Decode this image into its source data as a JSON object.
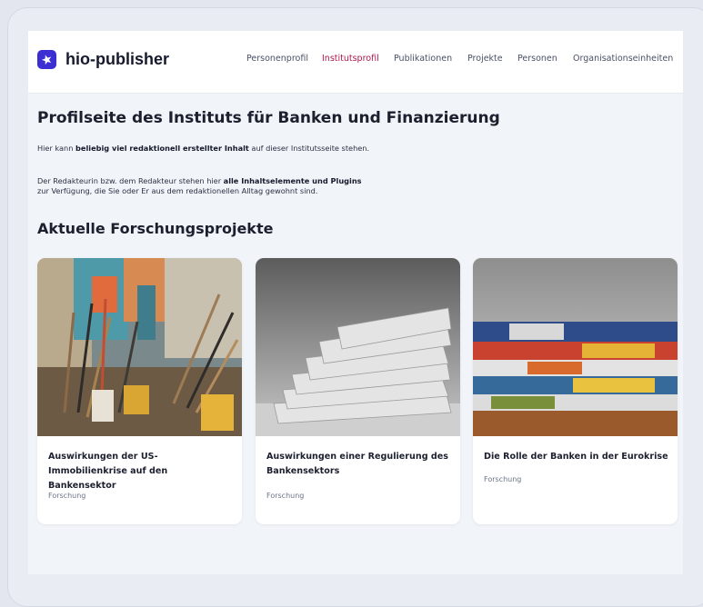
{
  "brand": {
    "name": "hio-publisher",
    "accent": "#3b2fd4"
  },
  "nav": {
    "items": [
      {
        "label": "Personenprofil",
        "active": false
      },
      {
        "label": "Institutsprofil",
        "active": true
      },
      {
        "label": "Publikationen",
        "active": false
      },
      {
        "label": "Projekte",
        "active": false
      },
      {
        "label": "Personen",
        "active": false
      },
      {
        "label": "Organisationseinheiten",
        "active": false
      }
    ],
    "active_color": "#b0174f"
  },
  "main": {
    "title": "Profilseite des Instituts für Banken und Finanzierung",
    "intro": {
      "pre": "Hier kann ",
      "bold": "beliebig viel redaktionell erstellter Inhalt",
      "post": " auf dieser Institutsseite stehen."
    },
    "text2": {
      "pre": "Der Redakteurin bzw. dem Redakteur stehen hier ",
      "bold": "alle Inhaltselemente und Plugins",
      "line2": "zur Verfügung, die Sie oder Er aus dem redaktionellen Alltag gewohnt sind."
    },
    "section_title": "Aktuelle Forschungsprojekte",
    "cards": [
      {
        "title": "Auswirkungen der US-Immobilienkrise auf den Bankensektor",
        "tag": "Forschung",
        "image": "paint-brushes-photo"
      },
      {
        "title": "Auswirkungen einer Regulierung des Bankensektors",
        "tag": "Forschung",
        "image": "newspaper-stack-photo"
      },
      {
        "title": "Die Rolle der Banken in der Eurokrise",
        "tag": "Forschung",
        "image": "colorful-newspapers-photo"
      }
    ]
  }
}
